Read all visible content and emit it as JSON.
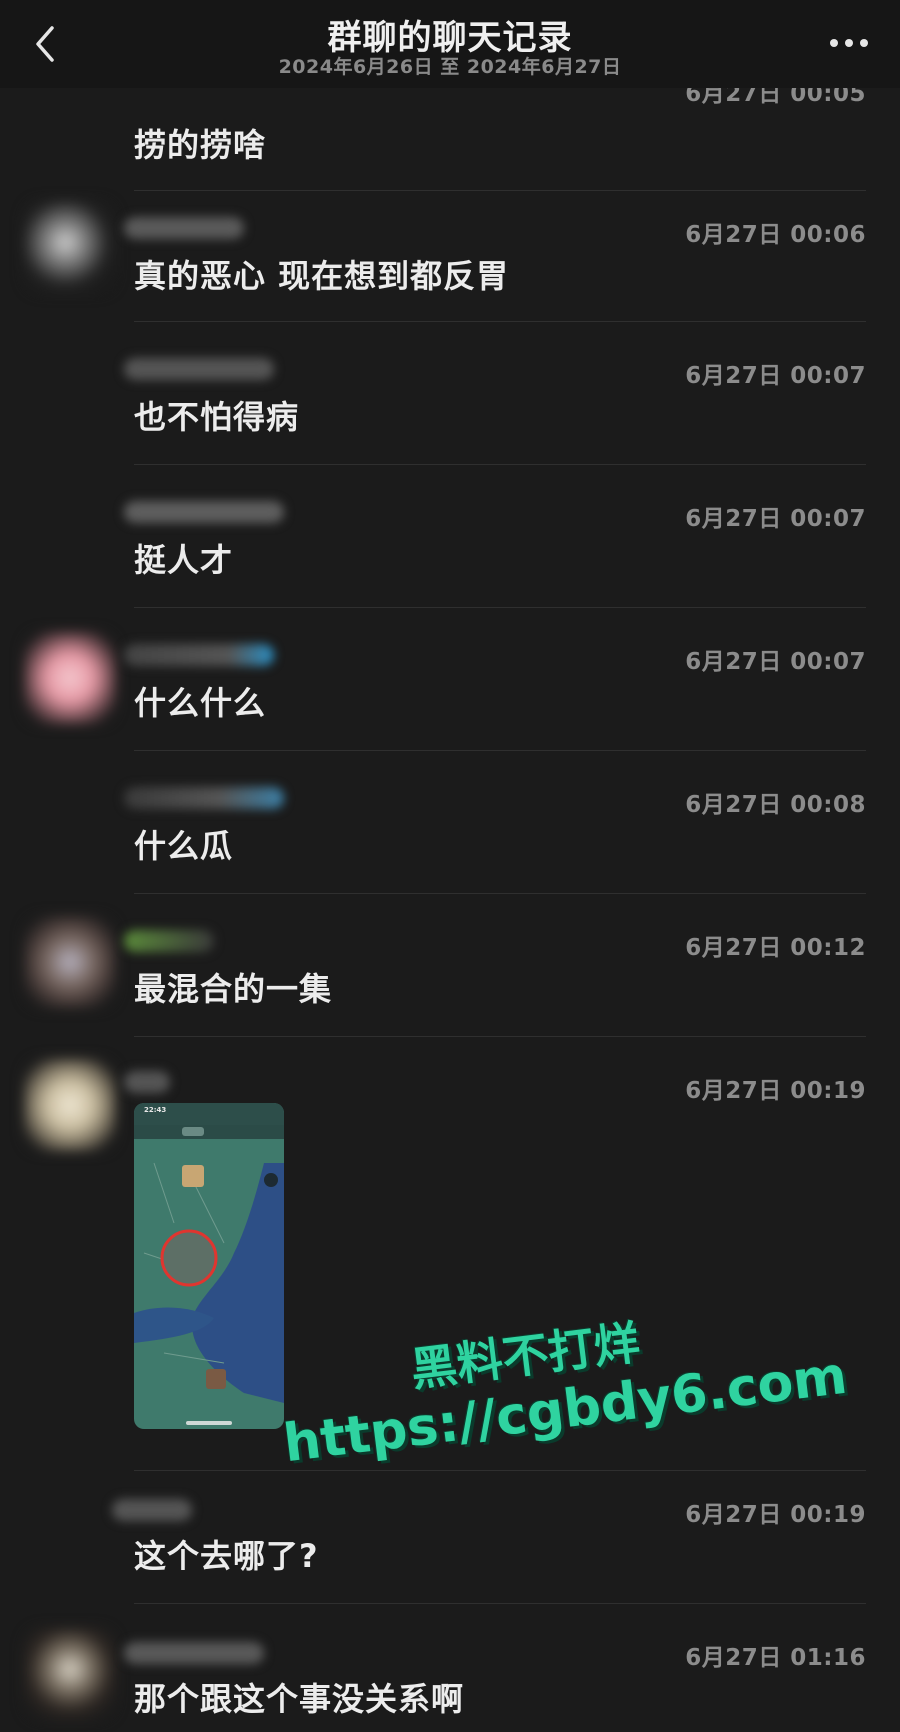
{
  "header": {
    "title": "群聊的聊天记录",
    "subtitle": "2024年6月26日 至 2024年6月27日"
  },
  "messages": [
    {
      "time": "6月27日 00:05",
      "text": "捞的捞啥"
    },
    {
      "time": "6月27日 00:06",
      "text": "真的恶心 现在想到都反胃"
    },
    {
      "time": "6月27日 00:07",
      "text": "也不怕得病"
    },
    {
      "time": "6月27日 00:07",
      "text": "挺人才"
    },
    {
      "time": "6月27日 00:07",
      "text": "什么什么"
    },
    {
      "time": "6月27日 00:08",
      "text": "什么瓜"
    },
    {
      "time": "6月27日 00:12",
      "text": "最混合的一集"
    },
    {
      "time": "6月27日 00:19",
      "text": ""
    },
    {
      "time": "6月27日 00:19",
      "text": "这个去哪了?"
    },
    {
      "time": "6月27日 01:16",
      "text": "那个跟这个事没关系啊"
    }
  ],
  "image_message": {
    "status_time": "22:43"
  },
  "watermark": {
    "line1": "黑料不打烊",
    "line2": "https://cgbdy6.com"
  },
  "icons": {
    "back": "chevron-left-icon",
    "more": "more-dots-icon"
  },
  "colors": {
    "background": "#1b1b1b",
    "header_bg": "#161616",
    "time_text": "#8c8c8c",
    "message_text": "#ececec",
    "watermark": "#2fd3a0"
  }
}
